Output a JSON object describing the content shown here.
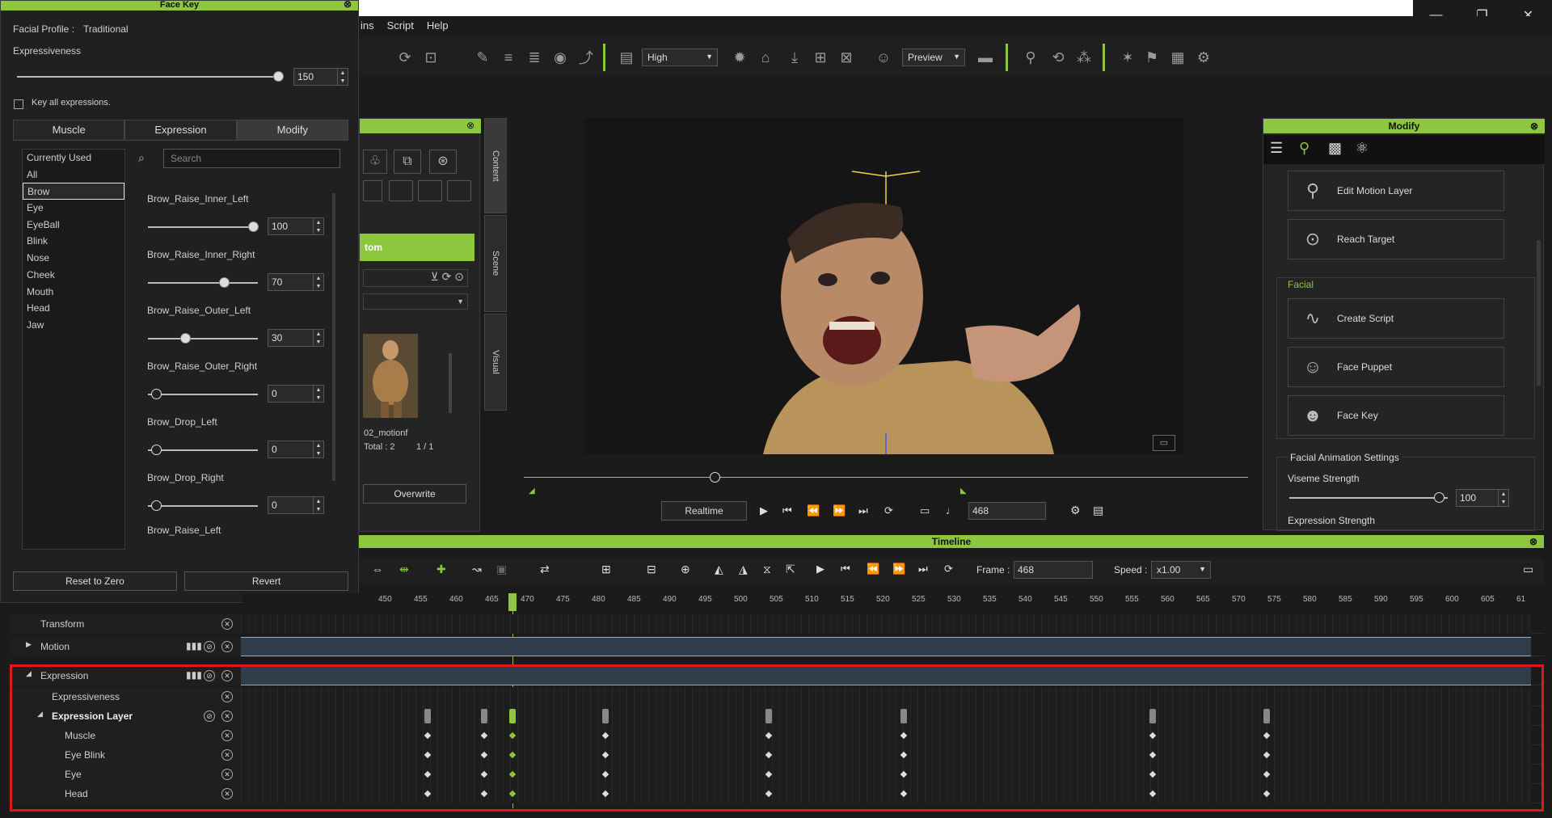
{
  "window": {
    "minimize": "—",
    "restore": "❐",
    "close": "✕"
  },
  "menu": [
    "ins",
    "Script",
    "Help"
  ],
  "toolbar": {
    "quality": "High",
    "preview": "Preview"
  },
  "facekey": {
    "title": "Face Key",
    "profile_label": "Facial Profile :",
    "profile_value": "Traditional",
    "expressiveness_label": "Expressiveness",
    "expressiveness_value": "150",
    "key_all": "Key all expressions.",
    "tabs": [
      "Muscle",
      "Expression",
      "Modify"
    ],
    "categories": [
      "Currently Used",
      "All",
      "Brow",
      "Eye",
      "EyeBall",
      "Blink",
      "Nose",
      "Cheek",
      "Mouth",
      "Head",
      "Jaw"
    ],
    "selected_category": "Brow",
    "search_placeholder": "Search",
    "sliders": [
      {
        "name": "Brow_Raise_Inner_Left",
        "value": "100",
        "level": 100
      },
      {
        "name": "Brow_Raise_Inner_Right",
        "value": "70",
        "level": 70
      },
      {
        "name": "Brow_Raise_Outer_Left",
        "value": "30",
        "level": 30
      },
      {
        "name": "Brow_Raise_Outer_Right",
        "value": "0",
        "level": 0
      },
      {
        "name": "Brow_Drop_Left",
        "value": "0",
        "level": 0
      },
      {
        "name": "Brow_Drop_Right",
        "value": "0",
        "level": 0
      }
    ],
    "last_item": "Brow_Raise_Left",
    "reset_button": "Reset to Zero",
    "revert_button": "Revert"
  },
  "content": {
    "tab_label": "tom",
    "item_label": "02_motionf",
    "total_label": "Total : 2",
    "page": "1 / 1",
    "overwrite_button": "Overwrite",
    "side_tabs": [
      "Content",
      "Scene",
      "Visual"
    ]
  },
  "playback": {
    "realtime": "Realtime",
    "frame": "468"
  },
  "modify": {
    "title": "Modify",
    "edit_motion_layer": "Edit Motion Layer",
    "reach_target": "Reach Target",
    "facial_section": "Facial",
    "create_script": "Create Script",
    "face_puppet": "Face Puppet",
    "face_key": "Face Key",
    "settings_section": "Facial Animation Settings",
    "viseme_label": "Viseme Strength",
    "viseme_value": "100",
    "expression_strength": "Expression Strength"
  },
  "timeline": {
    "title": "Timeline",
    "frame_label": "Frame :",
    "frame_value": "468",
    "speed_label": "Speed :",
    "speed_value": "x1.00",
    "ruler": [
      "450",
      "455",
      "460",
      "465",
      "470",
      "475",
      "480",
      "485",
      "490",
      "495",
      "500",
      "505",
      "510",
      "515",
      "520",
      "525",
      "530",
      "535",
      "540",
      "545",
      "550",
      "555",
      "560",
      "565",
      "570",
      "575",
      "580",
      "585",
      "590",
      "595",
      "600",
      "605",
      "61"
    ],
    "current_frame": 468,
    "tracks": {
      "transform": "Transform",
      "motion": "Motion",
      "expression": "Expression",
      "expressiveness": "Expressiveness",
      "expression_layer": "Expression Layer",
      "muscle": "Muscle",
      "eye_blink": "Eye Blink",
      "eye": "Eye",
      "head": "Head"
    },
    "keyframes": [
      456,
      464,
      468,
      481,
      504,
      523,
      558,
      574
    ]
  }
}
